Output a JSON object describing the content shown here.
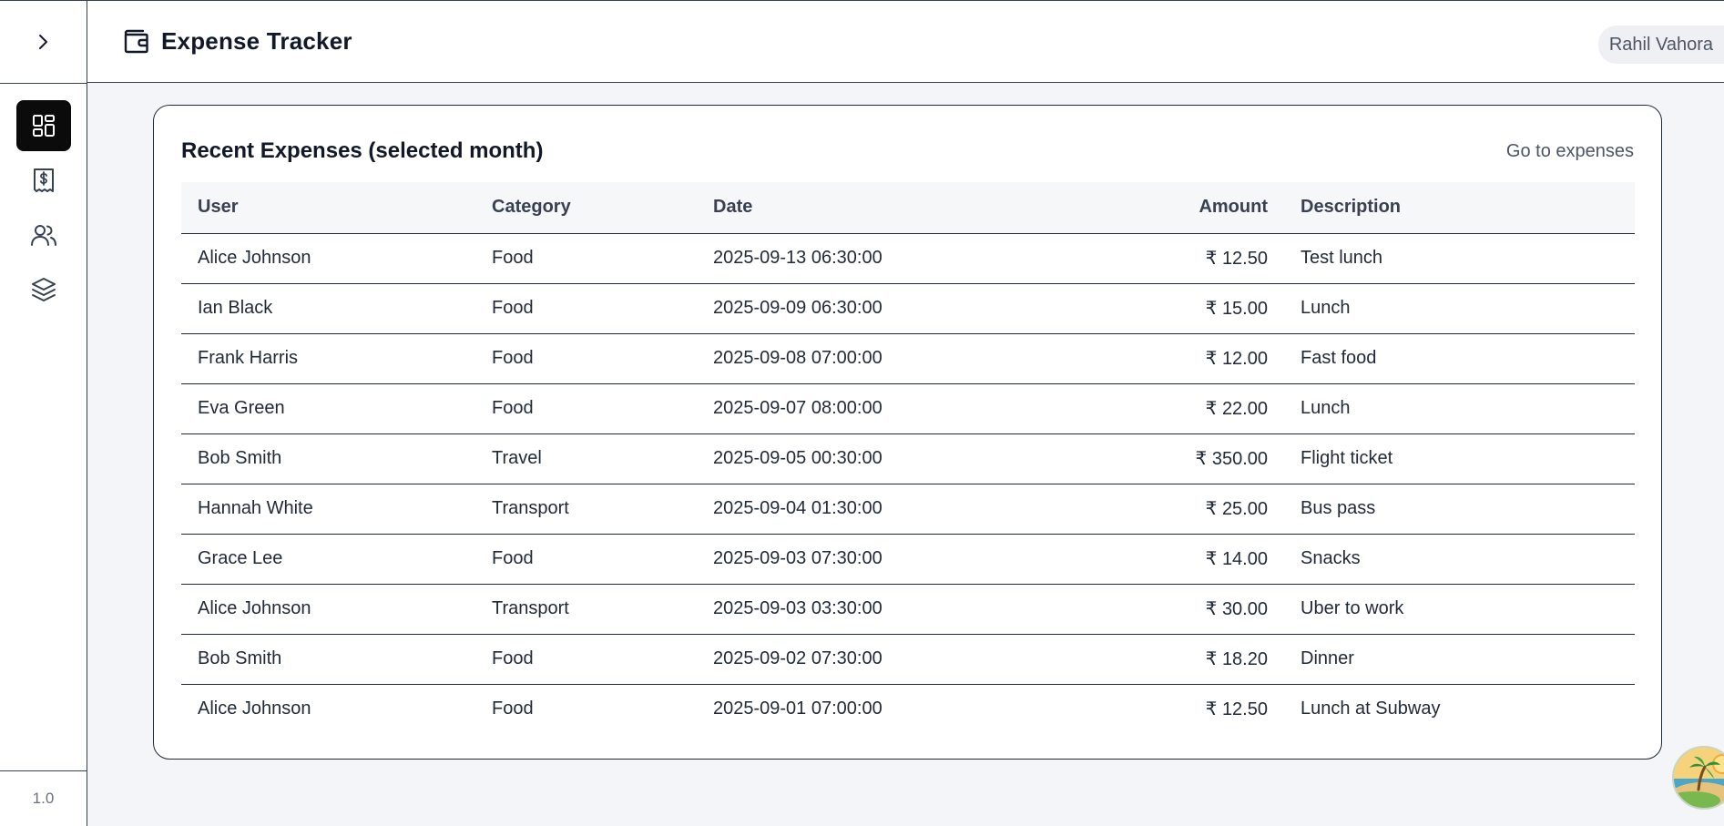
{
  "header": {
    "title": "Expense Tracker",
    "user": "Rahil Vahora"
  },
  "sidebar": {
    "toggle_icon": "chevron-right-icon",
    "items": [
      {
        "name": "dashboard",
        "icon": "dashboard-grid-icon",
        "active": true
      },
      {
        "name": "expenses",
        "icon": "receipt-dollar-icon",
        "active": false
      },
      {
        "name": "users",
        "icon": "users-icon",
        "active": false
      },
      {
        "name": "categories",
        "icon": "layers-icon",
        "active": false
      }
    ],
    "version": "1.0"
  },
  "recent": {
    "title": "Recent Expenses (selected month)",
    "link": "Go to expenses",
    "columns": [
      "User",
      "Category",
      "Date",
      "Amount",
      "Description"
    ],
    "rows": [
      [
        "Alice Johnson",
        "Food",
        "2025-09-13 06:30:00",
        "₹ 12.50",
        "Test lunch"
      ],
      [
        "Ian Black",
        "Food",
        "2025-09-09 06:30:00",
        "₹ 15.00",
        "Lunch"
      ],
      [
        "Frank Harris",
        "Food",
        "2025-09-08 07:00:00",
        "₹ 12.00",
        "Fast food"
      ],
      [
        "Eva Green",
        "Food",
        "2025-09-07 08:00:00",
        "₹ 22.00",
        "Lunch"
      ],
      [
        "Bob Smith",
        "Travel",
        "2025-09-05 00:30:00",
        "₹ 350.00",
        "Flight ticket"
      ],
      [
        "Hannah White",
        "Transport",
        "2025-09-04 01:30:00",
        "₹ 25.00",
        "Bus pass"
      ],
      [
        "Grace Lee",
        "Food",
        "2025-09-03 07:30:00",
        "₹ 14.00",
        "Snacks"
      ],
      [
        "Alice Johnson",
        "Transport",
        "2025-09-03 03:30:00",
        "₹ 30.00",
        "Uber to work"
      ],
      [
        "Bob Smith",
        "Food",
        "2025-09-02 07:30:00",
        "₹ 18.20",
        "Dinner"
      ],
      [
        "Alice Johnson",
        "Food",
        "2025-09-01 07:00:00",
        "₹ 12.50",
        "Lunch at Subway"
      ]
    ]
  },
  "colors": {
    "accent_dark": "#0b0b0b",
    "border": "#1f2937",
    "page_bg": "#f3f5f8"
  }
}
